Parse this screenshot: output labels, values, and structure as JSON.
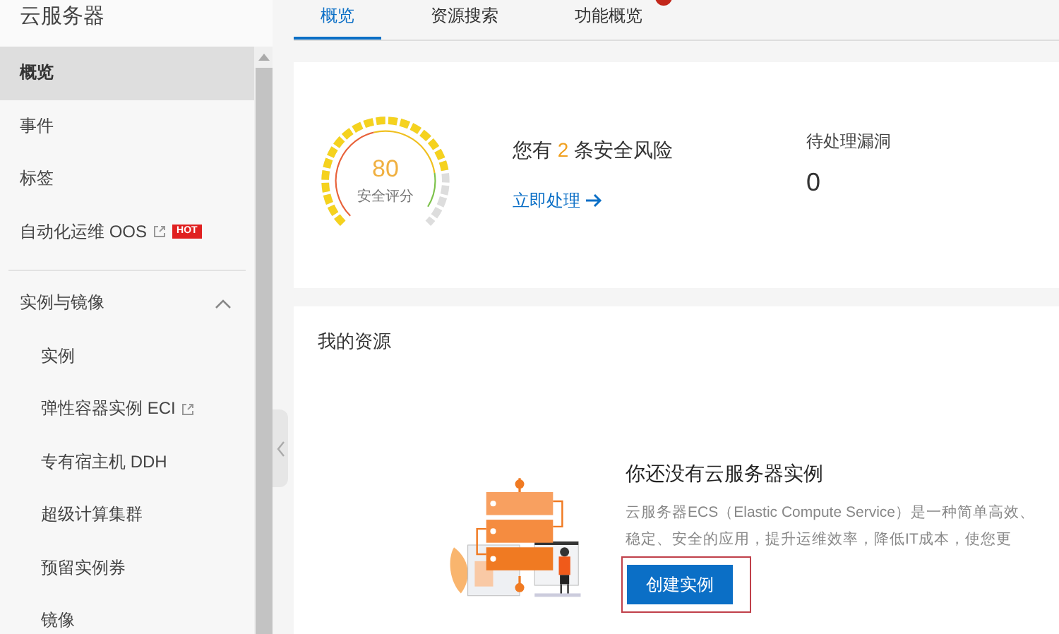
{
  "sidebar": {
    "title": "云服务器",
    "items": [
      {
        "label": "概览",
        "selected": true,
        "external": false
      },
      {
        "label": "事件",
        "selected": false,
        "external": false
      },
      {
        "label": "标签",
        "selected": false,
        "external": false
      },
      {
        "label": "自动化运维 OOS",
        "selected": false,
        "external": true,
        "badge": "HOT"
      }
    ],
    "group": {
      "label": "实例与镜像",
      "expanded": true,
      "children": [
        {
          "label": "实例",
          "external": false
        },
        {
          "label": "弹性容器实例 ECI",
          "external": true
        },
        {
          "label": "专有宿主机 DDH",
          "external": false
        },
        {
          "label": "超级计算集群",
          "external": false
        },
        {
          "label": "预留实例券",
          "external": false
        },
        {
          "label": "镜像",
          "external": false
        }
      ]
    }
  },
  "tabs": [
    {
      "label": "概览",
      "selected": true,
      "badge": false
    },
    {
      "label": "资源搜索",
      "selected": false,
      "badge": false
    },
    {
      "label": "功能概览",
      "selected": false,
      "badge": true
    }
  ],
  "security": {
    "score": "80",
    "score_label": "安全评分",
    "level": 0.8,
    "risk_prefix": "您有",
    "risk_count": "2",
    "risk_suffix": "条安全风险",
    "action": "立即处理",
    "pending_label": "待处理漏洞",
    "pending_value": "0"
  },
  "resources": {
    "title": "我的资源",
    "empty_title": "你还没有云服务器实例",
    "description_lines": [
      "云服务器ECS（Elastic Compute Service）是一种简单高效、",
      "稳定、安全的应用，提升运维效率，降低IT成本，使您更"
    ],
    "button": "创建实例"
  }
}
